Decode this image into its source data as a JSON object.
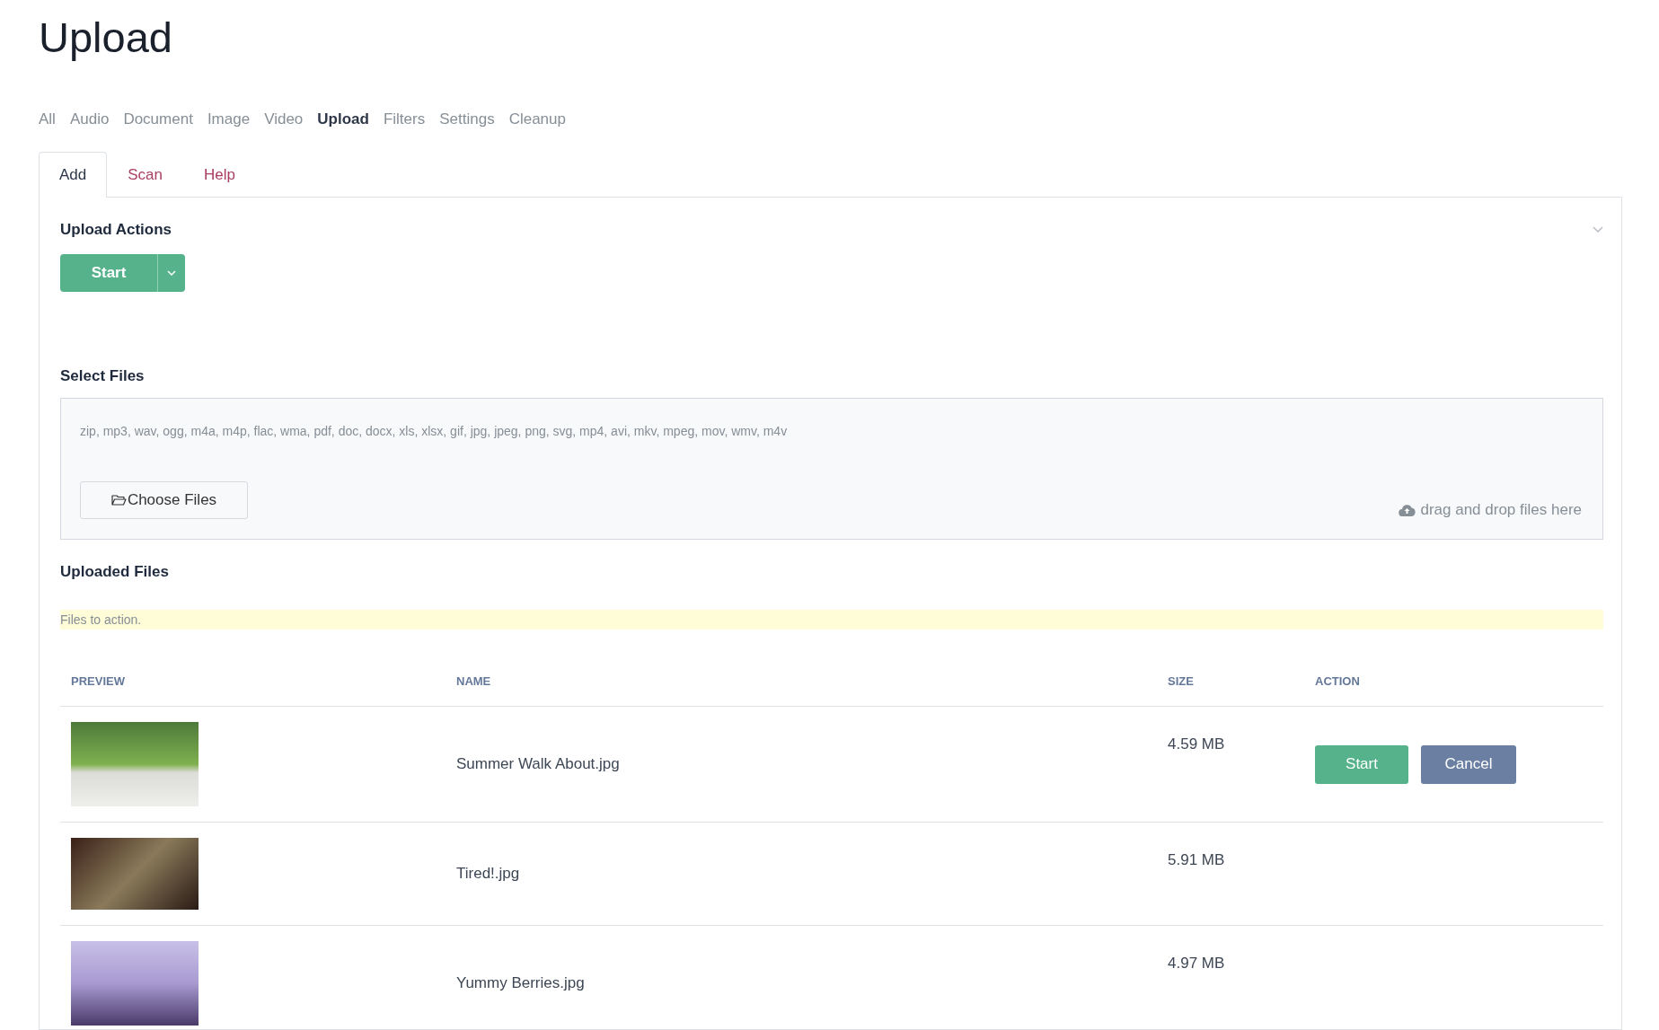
{
  "page_title": "Upload",
  "nav": [
    {
      "label": "All",
      "selected": false
    },
    {
      "label": "Audio",
      "selected": false
    },
    {
      "label": "Document",
      "selected": false
    },
    {
      "label": "Image",
      "selected": false
    },
    {
      "label": "Video",
      "selected": false
    },
    {
      "label": "Upload",
      "selected": true
    },
    {
      "label": "Filters",
      "selected": false
    },
    {
      "label": "Settings",
      "selected": false
    },
    {
      "label": "Cleanup",
      "selected": false
    }
  ],
  "tabs": [
    {
      "label": "Add",
      "selected": true
    },
    {
      "label": "Scan",
      "selected": false
    },
    {
      "label": "Help",
      "selected": false
    }
  ],
  "upload_actions": {
    "heading": "Upload Actions",
    "start_button": "Start",
    "expanded": true
  },
  "select_files": {
    "heading": "Select Files",
    "formats": "zip, mp3, wav, ogg, m4a, m4p, flac, wma, pdf, doc, docx, xls, xlsx, gif, jpg, jpeg, png, svg, mp4, avi, mkv, mpeg, mov, wmv, m4v",
    "choose_button": "Choose Files",
    "drop_hint": "drag and drop files here"
  },
  "uploaded_files": {
    "heading": "Uploaded Files",
    "notice": "Files to action.",
    "table": {
      "columns": [
        "PREVIEW",
        "NAME",
        "SIZE",
        "ACTION"
      ],
      "rows": [
        {
          "name": "Summer Walk About.jpg",
          "size": "4.59 MB",
          "actions": [
            {
              "label": "Start",
              "kind": "primary"
            },
            {
              "label": "Cancel",
              "kind": "secondary"
            }
          ]
        },
        {
          "name": "Tired!.jpg",
          "size": "5.91 MB",
          "actions": []
        },
        {
          "name": "Yummy Berries.jpg",
          "size": "4.97 MB",
          "actions": []
        }
      ]
    }
  }
}
